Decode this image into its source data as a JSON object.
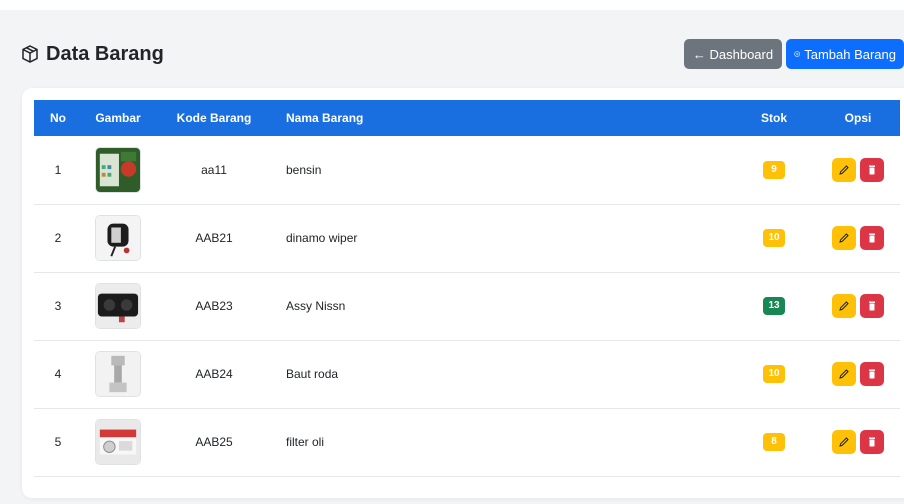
{
  "header": {
    "title": "Data Barang",
    "title_icon": "box-icon",
    "dashboard_button": "← Dashboard",
    "add_button": "Tambah Barang"
  },
  "table": {
    "columns": [
      "No",
      "Gambar",
      "Kode Barang",
      "Nama Barang",
      "Stok",
      "Opsi"
    ],
    "rows": [
      {
        "no": "1",
        "kode": "aa11",
        "nama": "bensin",
        "stok": "9",
        "stok_color": "#ffc107",
        "image": "green-product-photo"
      },
      {
        "no": "2",
        "kode": "AAB21",
        "nama": "dinamo wiper",
        "stok": "10",
        "stok_color": "#ffc107",
        "image": "wiper-motor-photo"
      },
      {
        "no": "3",
        "kode": "AAB23",
        "nama": "Assy Nissn",
        "stok": "13",
        "stok_color": "#198754",
        "image": "engine-assembly-photo"
      },
      {
        "no": "4",
        "kode": "AAB24",
        "nama": "Baut roda",
        "stok": "10",
        "stok_color": "#ffc107",
        "image": "wheel-bolt-photo"
      },
      {
        "no": "5",
        "kode": "AAB25",
        "nama": "filter oli",
        "stok": "8",
        "stok_color": "#ffc107",
        "image": "oil-filter-photo"
      }
    ]
  },
  "colors": {
    "header_bg": "#1a6fe0",
    "primary": "#0d6efd",
    "secondary": "#6c757d",
    "warning": "#ffc107",
    "danger": "#dc3545",
    "success": "#198754"
  }
}
